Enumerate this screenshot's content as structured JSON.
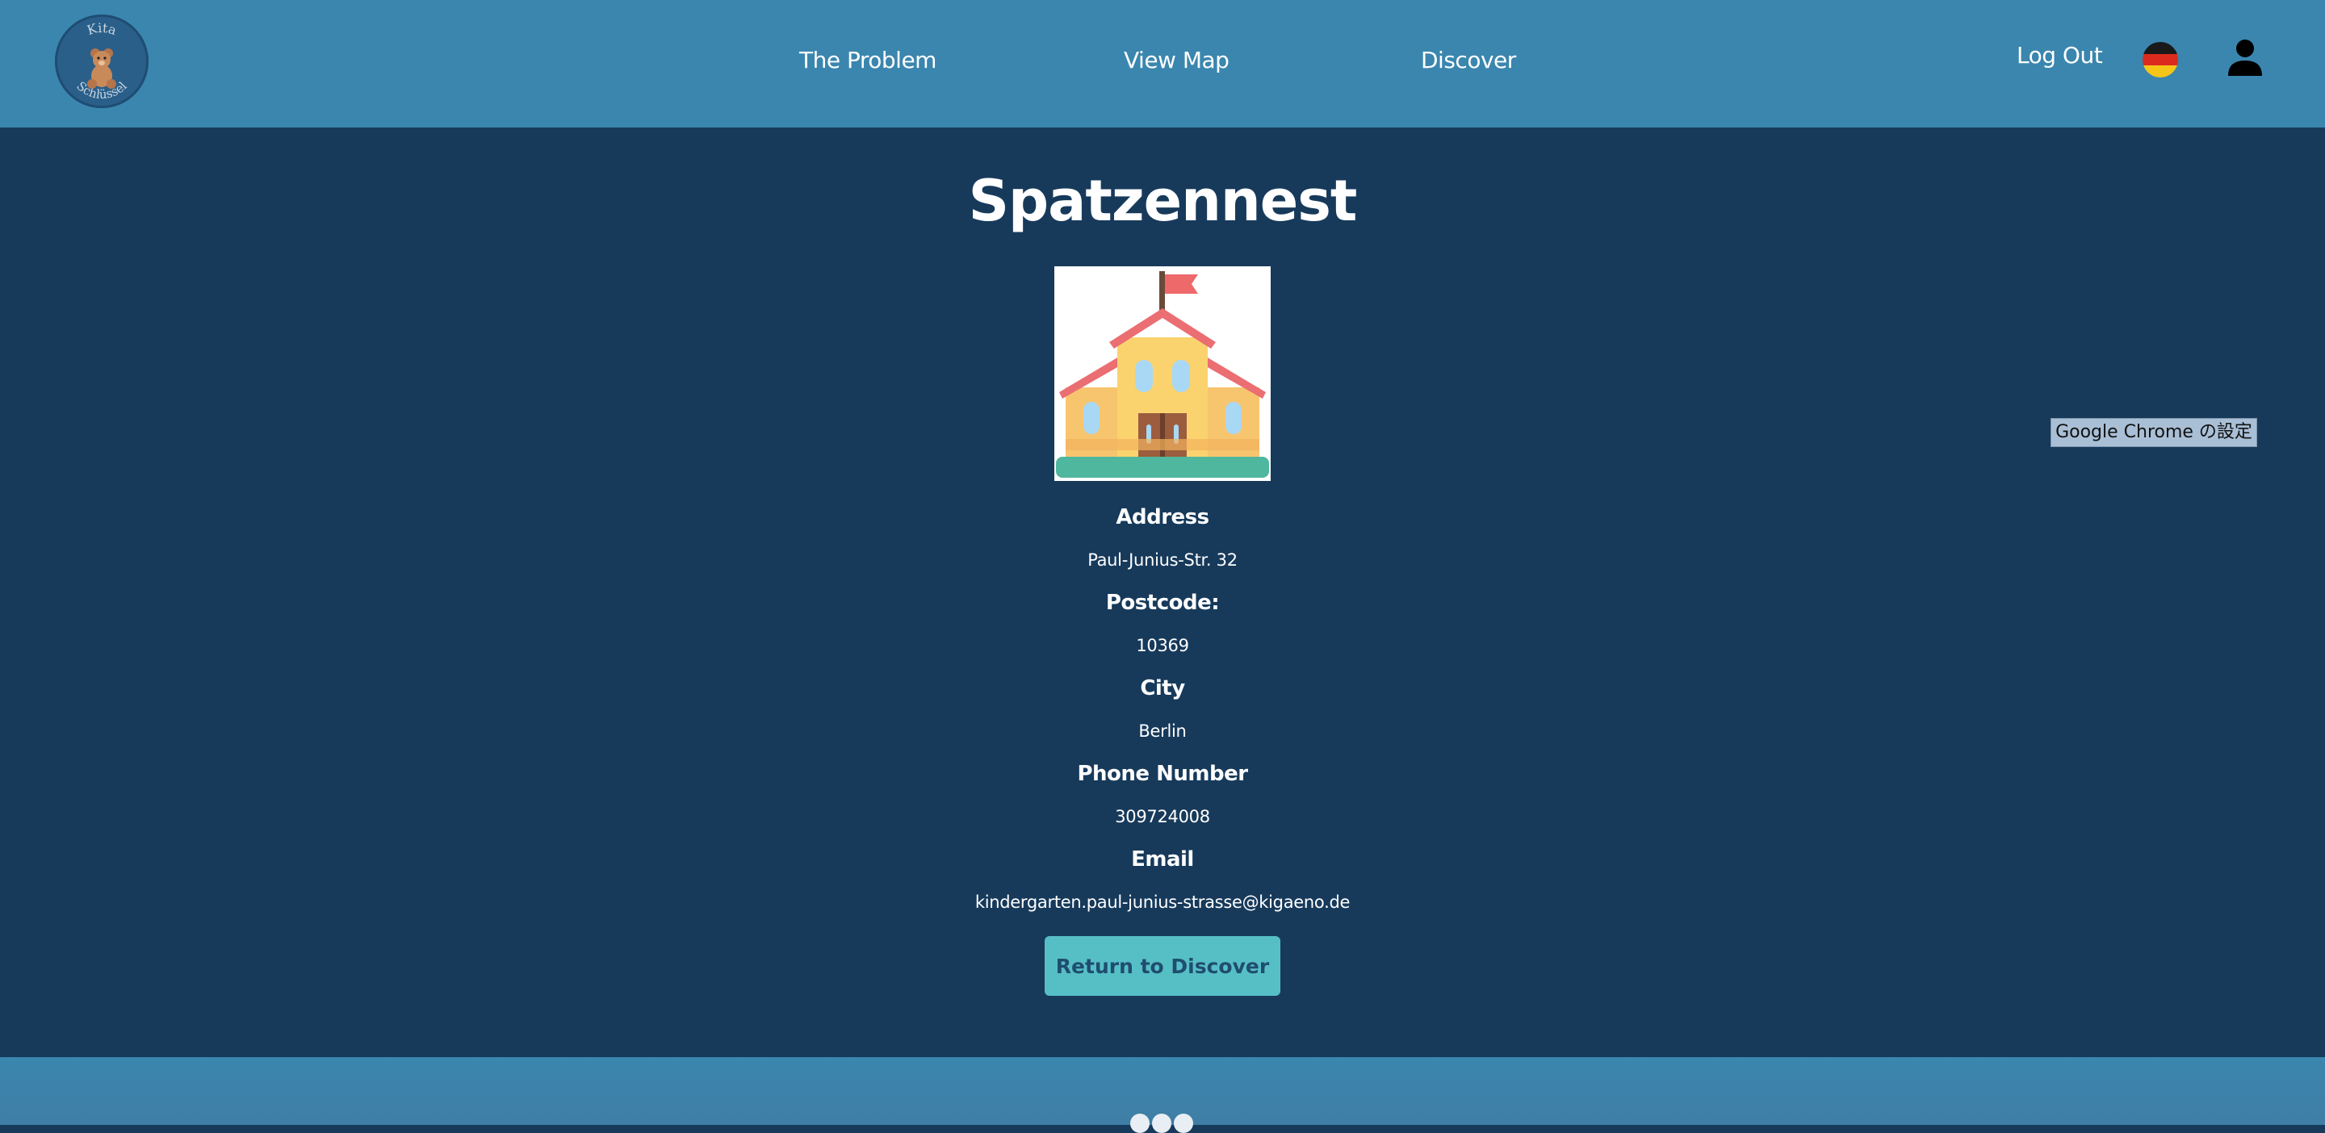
{
  "header": {
    "logo_text_top": "Kita",
    "logo_text_bottom": "Schlüssel",
    "nav": {
      "problem": "The Problem",
      "map": "View Map",
      "discover": "Discover"
    },
    "logout": "Log Out",
    "language_icon": "german-flag-icon",
    "user_icon": "user-icon"
  },
  "detail": {
    "name": "Spatzennest",
    "image_icon": "school-building-icon",
    "address_label": "Address",
    "address_value": "Paul-Junius-Str. 32",
    "postcode_label": "Postcode:",
    "postcode_value": "10369",
    "city_label": "City",
    "city_value": "Berlin",
    "phone_label": "Phone Number",
    "phone_value": "309724008",
    "email_label": "Email",
    "email_value": "kindergarten.paul-junius-strasse@kigaeno.de",
    "return_button": "Return to Discover"
  },
  "chrome_tooltip": "Google Chrome の設定",
  "footer": {
    "social_icons": [
      "facebook-icon",
      "twitter-icon",
      "instagram-icon"
    ]
  },
  "colors": {
    "header_bg": "#3a86ae",
    "main_bg": "#173a5b",
    "button_bg": "#56bfc6"
  }
}
